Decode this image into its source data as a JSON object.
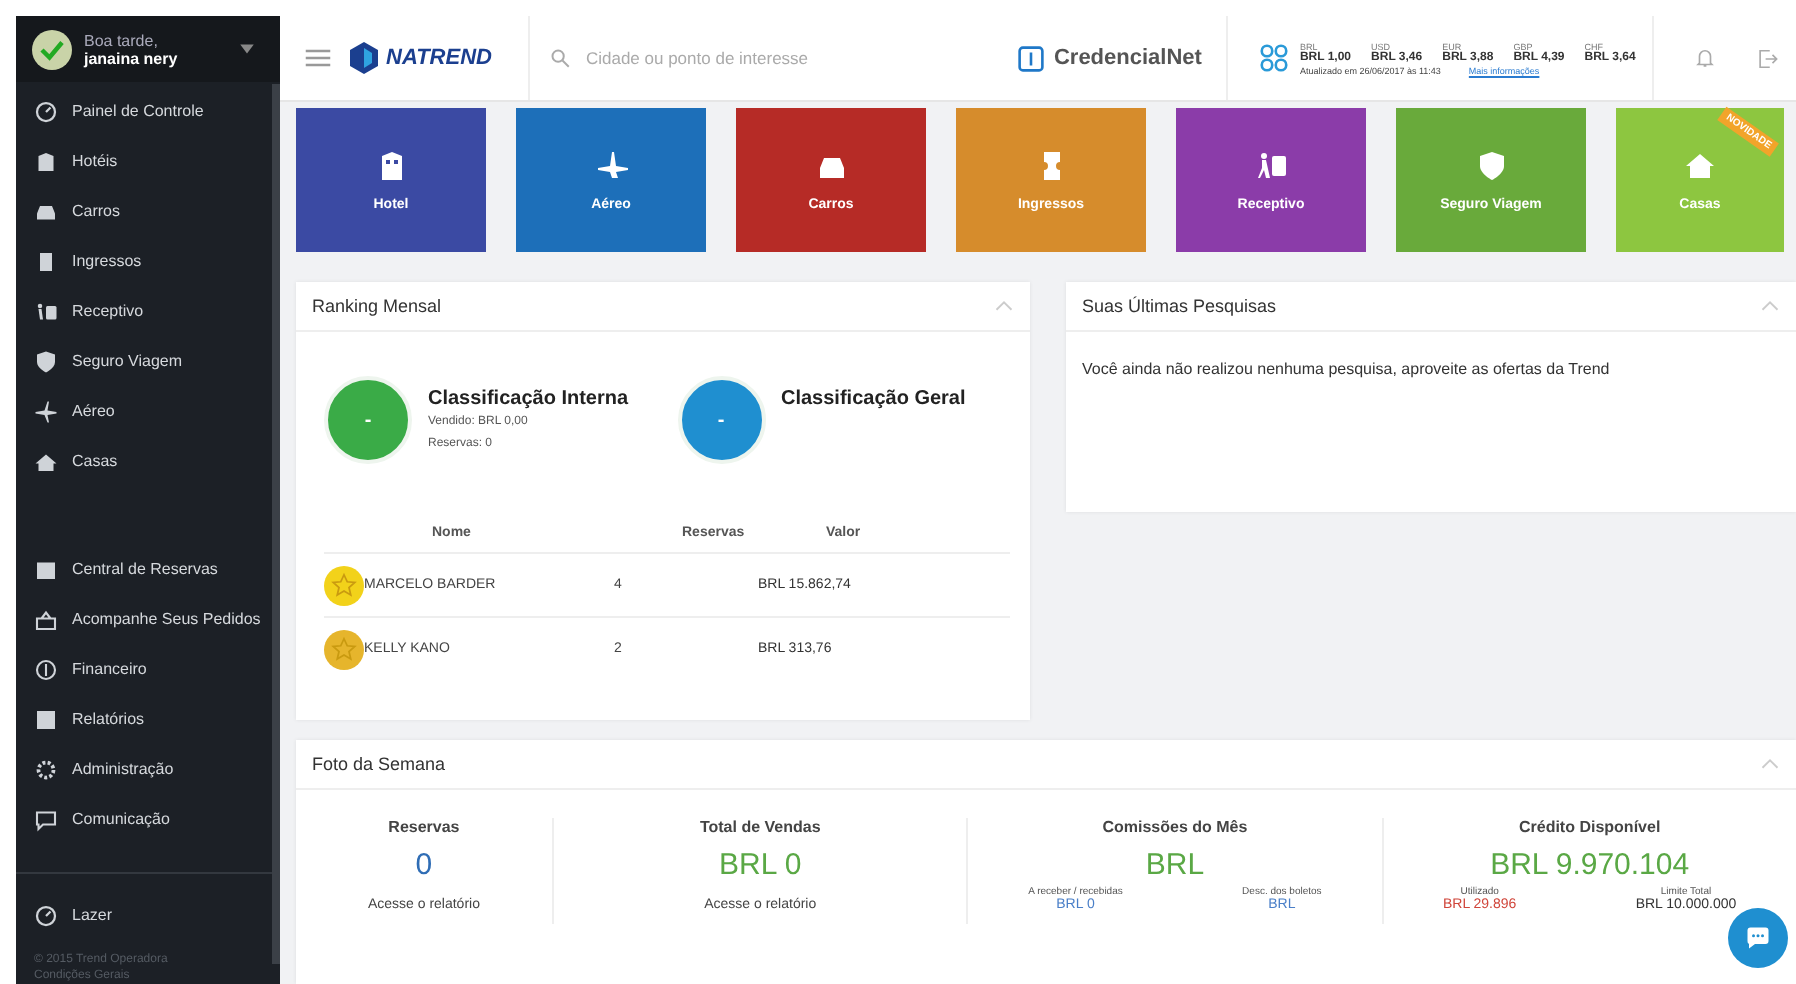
{
  "sidebar": {
    "greeting": "Boa tarde,",
    "user": "janaina nery",
    "items": [
      {
        "label": "Painel de Controle"
      },
      {
        "label": "Hotéis"
      },
      {
        "label": "Carros"
      },
      {
        "label": "Ingressos"
      },
      {
        "label": "Receptivo"
      },
      {
        "label": "Seguro Viagem"
      },
      {
        "label": "Aéreo"
      },
      {
        "label": "Casas"
      }
    ],
    "items_2": [
      {
        "label": "Central de Reservas"
      },
      {
        "label": "Acompanhe Seus Pedidos"
      },
      {
        "label": "Financeiro"
      },
      {
        "label": "Relatórios"
      },
      {
        "label": "Administração"
      },
      {
        "label": "Comunicação"
      }
    ],
    "items_3": [
      {
        "label": "Lazer"
      }
    ],
    "footer": [
      "© 2015 Trend Operadora",
      "Condições Gerais"
    ]
  },
  "header": {
    "logo": "NATREND",
    "search": {
      "placeholder": "Cidade ou ponto de interesse"
    },
    "credencial": "CredencialNet",
    "rates": [
      {
        "currency": "BRL",
        "value": "BRL 1,00"
      },
      {
        "currency": "USD",
        "value": "BRL 3,46"
      },
      {
        "currency": "EUR",
        "value": "BRL 3,88"
      },
      {
        "currency": "GBP",
        "value": "BRL 4,39"
      },
      {
        "currency": "CHF",
        "value": "BRL 3,64"
      }
    ],
    "updated": "Atualizado em 26/06/2017 às 11:43",
    "more_link": "Mais informações"
  },
  "tiles": [
    {
      "label": "Hotel",
      "color": "#3b4aa3"
    },
    {
      "label": "Aéreo",
      "color": "#1d6fb9"
    },
    {
      "label": "Carros",
      "color": "#b62b26"
    },
    {
      "label": "Ingressos",
      "color": "#d68c2c"
    },
    {
      "label": "Receptivo",
      "color": "#8b3ca9"
    },
    {
      "label": "Seguro Viagem",
      "color": "#69aa3b"
    },
    {
      "label": "Casas",
      "color": "#8dc640",
      "ribbon": "NOVIDADE"
    }
  ],
  "ranking": {
    "title": "Ranking Mensal",
    "internal": {
      "badge": "-",
      "title": "Classificação Interna",
      "sold": "Vendido: BRL 0,00",
      "bookings": "Reservas: 0"
    },
    "general": {
      "badge": "-",
      "title": "Classificação Geral"
    },
    "columns": [
      "Nome",
      "Reservas",
      "Valor"
    ],
    "rows": [
      {
        "color": "#f2d21a",
        "name": "MARCELO BARDER",
        "bookings": "4",
        "value": "BRL 15.862,74"
      },
      {
        "color": "#e6b52c",
        "name": "KELLY KANO",
        "bookings": "2",
        "value": "BRL 313,76"
      }
    ]
  },
  "searches": {
    "title": "Suas Últimas Pesquisas",
    "message": "Você ainda não realizou nenhuma pesquisa, aproveite as ofertas da Trend"
  },
  "week": {
    "title": "Foto da Semana",
    "stats": [
      {
        "title": "Reservas",
        "value": "0",
        "kind": "count",
        "link": "Acesse o relatório"
      },
      {
        "title": "Total de Vendas",
        "value": "BRL 0",
        "kind": "money",
        "link": "Acesse o relatório"
      },
      {
        "title": "Comissões do Mês",
        "value": "BRL",
        "kind": "money",
        "subs": [
          {
            "label": "A receber / recebidas",
            "value": "BRL 0",
            "color": "#4a7fc8"
          },
          {
            "label": "Desc. dos boletos",
            "value": "BRL",
            "color": "#4a7fc8"
          }
        ]
      },
      {
        "title": "Crédito Disponível",
        "value": "BRL 9.970.104",
        "kind": "money",
        "subs": [
          {
            "label": "Utilizado",
            "value": "BRL 29.896",
            "color": "#d0453a"
          },
          {
            "label": "Limite Total",
            "value": "BRL 10.000.000",
            "color": "#333333"
          }
        ]
      }
    ]
  }
}
